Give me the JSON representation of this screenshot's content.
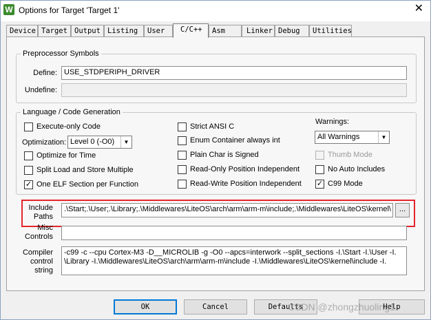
{
  "window": {
    "title": "Options for Target 'Target 1'",
    "app_icon_glyph": "W",
    "close_glyph": "✕"
  },
  "tabs": [
    {
      "label": "Device"
    },
    {
      "label": "Target"
    },
    {
      "label": "Output"
    },
    {
      "label": "Listing"
    },
    {
      "label": "User"
    },
    {
      "label": "C/C++",
      "active": true
    },
    {
      "label": "Asm"
    },
    {
      "label": "Linker"
    },
    {
      "label": "Debug"
    },
    {
      "label": "Utilities"
    }
  ],
  "preprocessor": {
    "legend": "Preprocessor Symbols",
    "define_label": "Define:",
    "define_value": "USE_STDPERIPH_DRIVER",
    "undefine_label": "Undefine:",
    "undefine_value": ""
  },
  "codegen": {
    "legend": "Language / Code Generation",
    "execute_only": {
      "label": "Execute-only Code",
      "checked": false
    },
    "optimization_label": "Optimization:",
    "optimization_value": "Level 0 (-O0)",
    "optimize_time": {
      "label": "Optimize for Time",
      "checked": false
    },
    "split_load": {
      "label": "Split Load and Store Multiple",
      "checked": false
    },
    "one_elf": {
      "label": "One ELF Section per Function",
      "checked": true
    },
    "strict_ansi": {
      "label": "Strict ANSI C",
      "checked": false
    },
    "enum_int": {
      "label": "Enum Container always int",
      "checked": false
    },
    "plain_char": {
      "label": "Plain Char is Signed",
      "checked": false
    },
    "ro_pi": {
      "label": "Read-Only Position Independent",
      "checked": false
    },
    "rw_pi": {
      "label": "Read-Write Position Independent",
      "checked": false
    },
    "warnings_label": "Warnings:",
    "warnings_value": "All Warnings",
    "thumb_mode": {
      "label": "Thumb Mode",
      "checked": false,
      "disabled": true
    },
    "no_auto_includes": {
      "label": "No Auto Includes",
      "checked": false
    },
    "c99_mode": {
      "label": "C99 Mode",
      "checked": true
    }
  },
  "include": {
    "label_line1": "Include",
    "label_line2": "Paths",
    "value": ".\\Start;.\\User;.\\Library;.\\Middlewares\\LiteOS\\arch\\arm\\arm-m\\include;.\\Middlewares\\LiteOS\\kernel\\",
    "browse_label": "..."
  },
  "misc": {
    "label_line1": "Misc",
    "label_line2": "Controls",
    "value": ""
  },
  "compiler": {
    "label_line1": "Compiler",
    "label_line2": "control",
    "label_line3": "string",
    "line1": "-c99 -c --cpu Cortex-M3 -D__MICROLIB -g -O0 --apcs=interwork --split_sections -I.\\Start -I.\\User -I.",
    "line2": "\\Library -I.\\Middlewares\\LiteOS\\arch\\arm\\arm-m\\include -I.\\Middlewares\\LiteOS\\kernel\\include -I."
  },
  "buttons": {
    "ok": "OK",
    "cancel": "Cancel",
    "defaults": "Defaults",
    "help": "Help"
  },
  "watermark": "CSDN @zhongzhuoling1",
  "colors": {
    "highlight": "#e5242b",
    "app_icon": "#3c8a2e"
  }
}
